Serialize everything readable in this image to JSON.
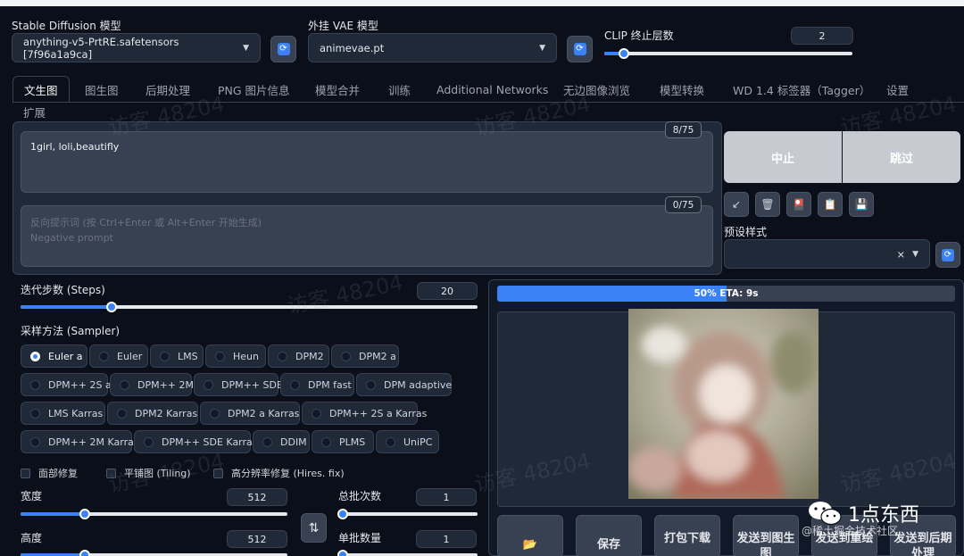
{
  "model": {
    "sd_label": "Stable Diffusion 模型",
    "sd_value": "anything-v5-PrtRE.safetensors [7f96a1a9ca]",
    "vae_label": "外挂 VAE 模型",
    "vae_value": "animevae.pt",
    "clip_label": "CLIP 终止层数",
    "clip_value": "2",
    "clip_level": 0.08
  },
  "tabs": [
    "文生图",
    "图生图",
    "后期处理",
    "PNG 图片信息",
    "模型合并",
    "训练",
    "Additional Networks",
    "无边图像浏览",
    "模型转换",
    "WD 1.4 标签器（Tagger）",
    "设置",
    "扩展"
  ],
  "prompt": {
    "positive": "1girl, loli,beautifly",
    "positive_count": "8/75",
    "negative_placeholder_cn": "反向提示词 (按 Ctrl+Enter 或 Alt+Enter 开始生成)",
    "negative_placeholder_en": "Negative prompt",
    "negative_count": "0/75"
  },
  "actions": {
    "interrupt": "中止",
    "skip": "跳过",
    "styles_label": "预设样式",
    "clear_symbol": "×",
    "tool_icons": [
      "↙",
      "🗑",
      "🎴",
      "📋",
      "💾"
    ]
  },
  "steps": {
    "label": "迭代步数 (Steps)",
    "value": "20",
    "level": 0.2
  },
  "sampler": {
    "label": "采样方法 (Sampler)",
    "selected": "Euler a",
    "options": [
      "Euler a",
      "Euler",
      "LMS",
      "Heun",
      "DPM2",
      "DPM2 a",
      "DPM++ 2S a",
      "DPM++ 2M",
      "DPM++ SDE",
      "DPM fast",
      "DPM adaptive",
      "LMS Karras",
      "DPM2 Karras",
      "DPM2 a Karras",
      "DPM++ 2S a Karras",
      "DPM++ 2M Karras",
      "DPM++ SDE Karras",
      "DDIM",
      "PLMS",
      "UniPC"
    ]
  },
  "checks": {
    "face_restore": "面部修复",
    "tiling": "平铺图 (Tiling)",
    "hires": "高分辨率修复 (Hires. fix)"
  },
  "size": {
    "width_label": "宽度",
    "width_value": "512",
    "width_level": 0.24,
    "height_label": "高度",
    "height_value": "512",
    "height_level": 0.24,
    "swap_symbol": "⇅"
  },
  "batch": {
    "count_label": "总批次数",
    "count_value": "1",
    "count_level": 0.03,
    "size_label": "单批数量",
    "size_value": "1",
    "size_level": 0.03
  },
  "progress": {
    "text": "50% ETA: 9s",
    "fraction": 0.5
  },
  "output_buttons": [
    "📂",
    "保存",
    "打包下载",
    "发送到图生图",
    "发送到重绘",
    "发送到后期处理"
  ],
  "watermark": "访客 48204",
  "brand": {
    "name": "1点东西",
    "sub": "@稀土掘金技术社区"
  },
  "colors": {
    "accent": "#3b82f6",
    "bg": "#0b0f19",
    "panel": "#1f2937",
    "interrupt_btn": "#c7cbd1"
  }
}
